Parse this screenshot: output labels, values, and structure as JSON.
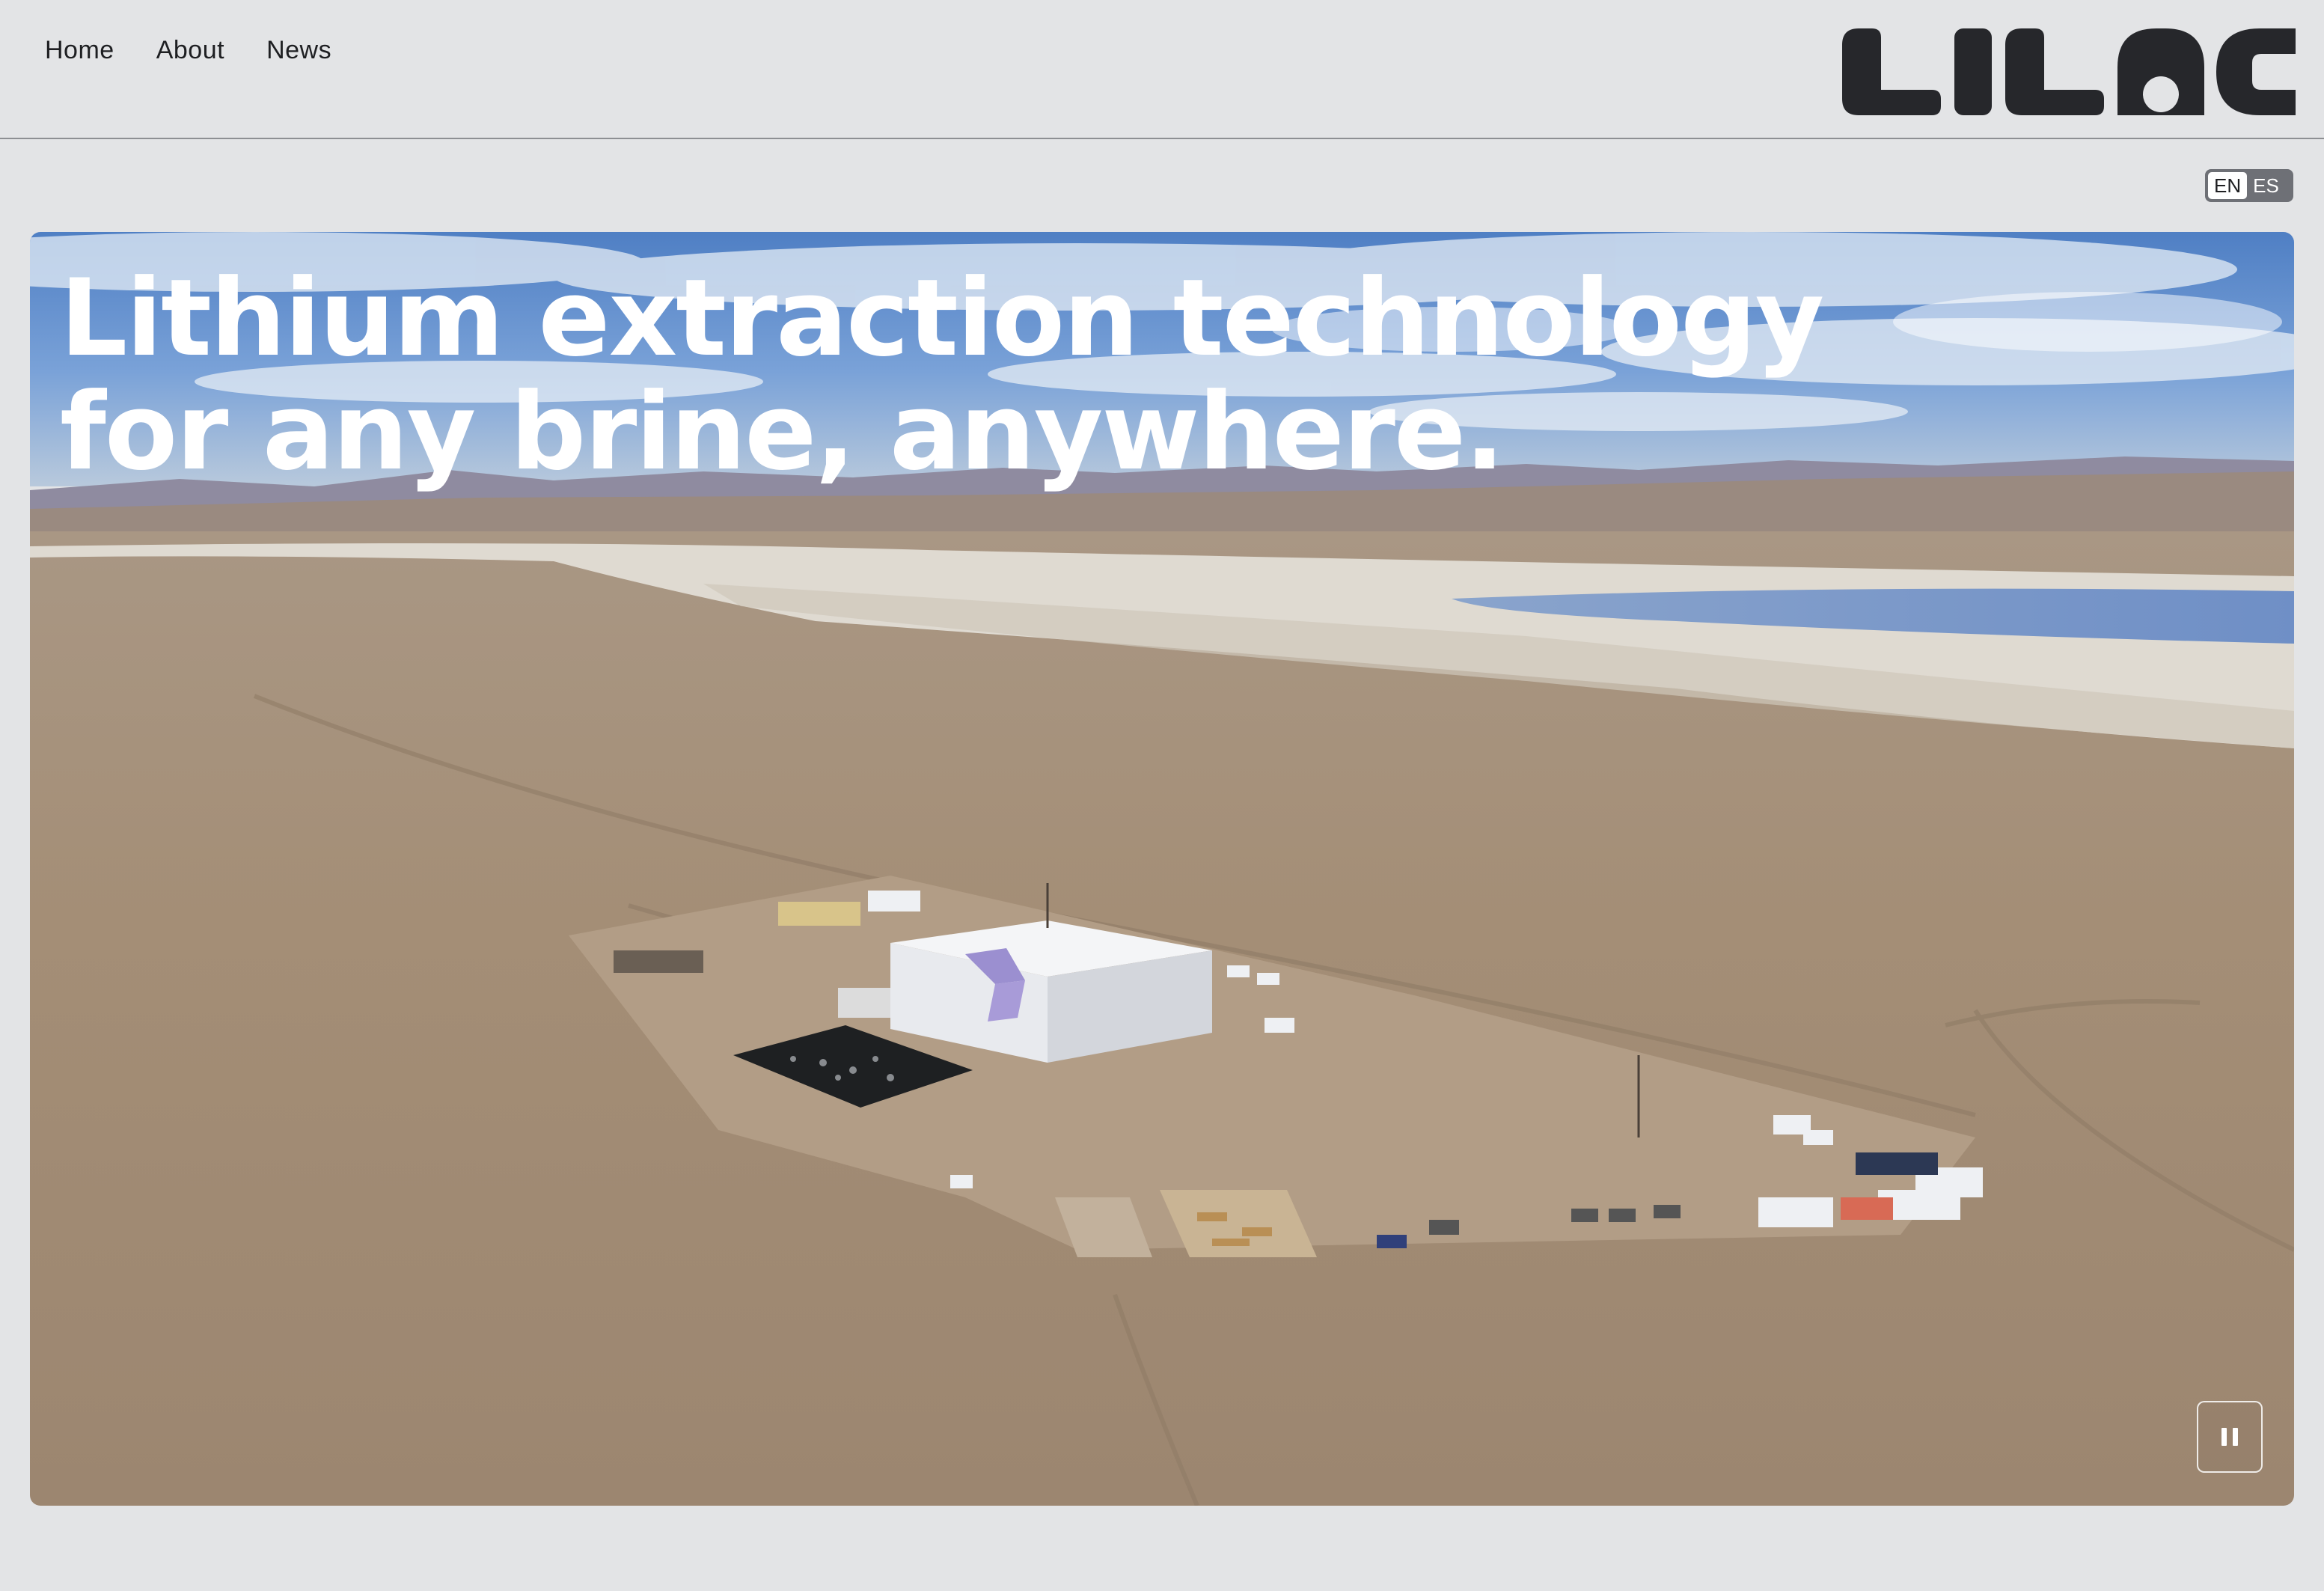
{
  "nav": {
    "items": [
      {
        "label": "Home"
      },
      {
        "label": "About"
      },
      {
        "label": "News"
      }
    ]
  },
  "brand": {
    "logo_text": "LILAC",
    "logo_color": "#26272b"
  },
  "language": {
    "options": [
      "EN",
      "ES"
    ],
    "selected": "EN"
  },
  "hero": {
    "headline": "Lithium extraction technology\nfor any brine, anywhere.",
    "media": "aerial-video-salt-flat-facility",
    "control": "pause-icon"
  },
  "colors": {
    "page_bg": "#e3e4e6",
    "text": "#1e1f22",
    "accent_stripe": "#9b8fd0"
  }
}
